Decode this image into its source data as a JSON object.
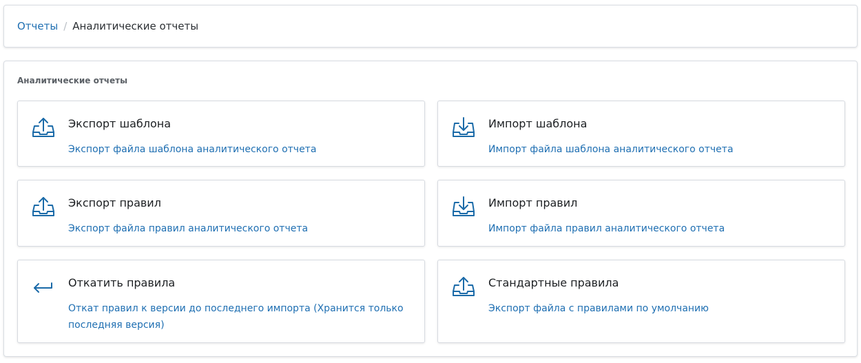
{
  "breadcrumb": {
    "parent": "Отчеты",
    "separator": "/",
    "current": "Аналитические отчеты"
  },
  "panel": {
    "title": "Аналитические отчеты"
  },
  "cards": [
    {
      "icon": "export-icon",
      "title": "Экспорт шаблона",
      "description": "Экспорт файла шаблона аналитического отчета"
    },
    {
      "icon": "import-icon",
      "title": "Импорт шаблона",
      "description": "Импорт файла шаблона аналитического отчета"
    },
    {
      "icon": "export-icon",
      "title": "Экспорт правил",
      "description": "Экспорт файла правил аналитического отчета"
    },
    {
      "icon": "import-icon",
      "title": "Импорт правил",
      "description": "Импорт файла правил аналитического отчета"
    },
    {
      "icon": "rollback-icon",
      "title": "Откатить правила",
      "description": "Откат правил к версии до последнего импорта (Хранится только последняя версия)"
    },
    {
      "icon": "export-icon",
      "title": "Стандартные правила",
      "description": "Экспорт файла с правилами по умолчанию"
    }
  ],
  "colors": {
    "accent": "#1f6fb2",
    "icon": "#1a6aa8"
  }
}
